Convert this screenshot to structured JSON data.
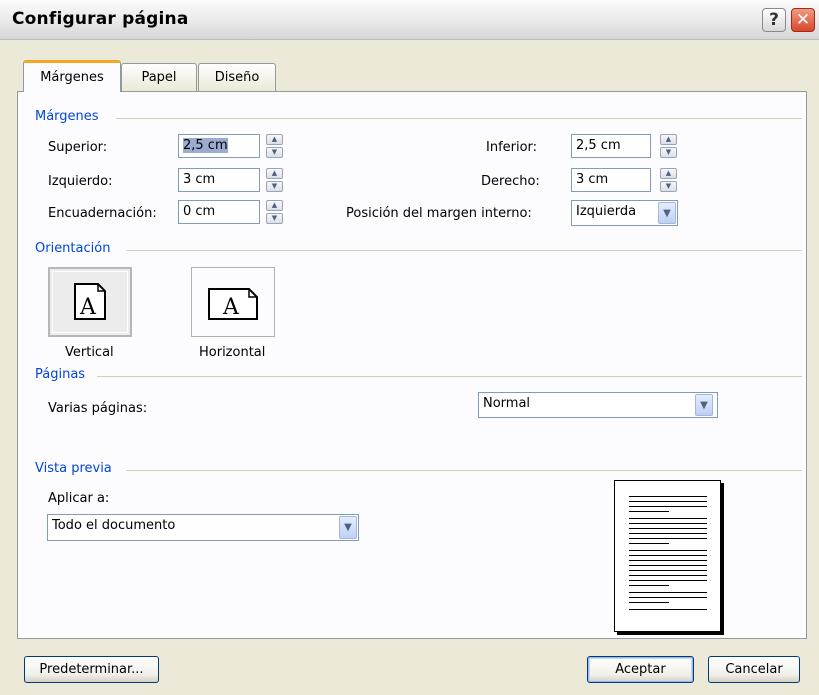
{
  "window": {
    "title": "Configurar página",
    "help_label": "?",
    "close_label": "✕"
  },
  "tabs": [
    {
      "label": "Márgenes",
      "active": true
    },
    {
      "label": "Papel",
      "active": false
    },
    {
      "label": "Diseño",
      "active": false
    }
  ],
  "margins": {
    "group_label": "Márgenes",
    "top_label": "Superior:",
    "top_value": "2,5 cm",
    "left_label": "Izquierdo:",
    "left_value": "3 cm",
    "gutter_label": "Encuadernación:",
    "gutter_value": "0 cm",
    "bottom_label": "Inferior:",
    "bottom_value": "2,5 cm",
    "right_label": "Derecho:",
    "right_value": "3 cm",
    "gutter_pos_label": "Posición del margen interno:",
    "gutter_pos_value": "Izquierda"
  },
  "orientation": {
    "group_label": "Orientación",
    "vertical_label": "Vertical",
    "horizontal_label": "Horizontal",
    "icon_glyph": "A",
    "selected": "vertical"
  },
  "pages": {
    "group_label": "Páginas",
    "multiple_label": "Varias páginas:",
    "multiple_value": "Normal"
  },
  "preview": {
    "group_label": "Vista previa",
    "apply_label": "Aplicar a:",
    "apply_value": "Todo el documento"
  },
  "footer": {
    "default_label": "Predeterminar...",
    "ok_label": "Aceptar",
    "cancel_label": "Cancelar"
  },
  "colors": {
    "group_label": "#0046d5",
    "dialog_bg": "#ECE9D8",
    "active_tab_accent": "#f5a623"
  }
}
